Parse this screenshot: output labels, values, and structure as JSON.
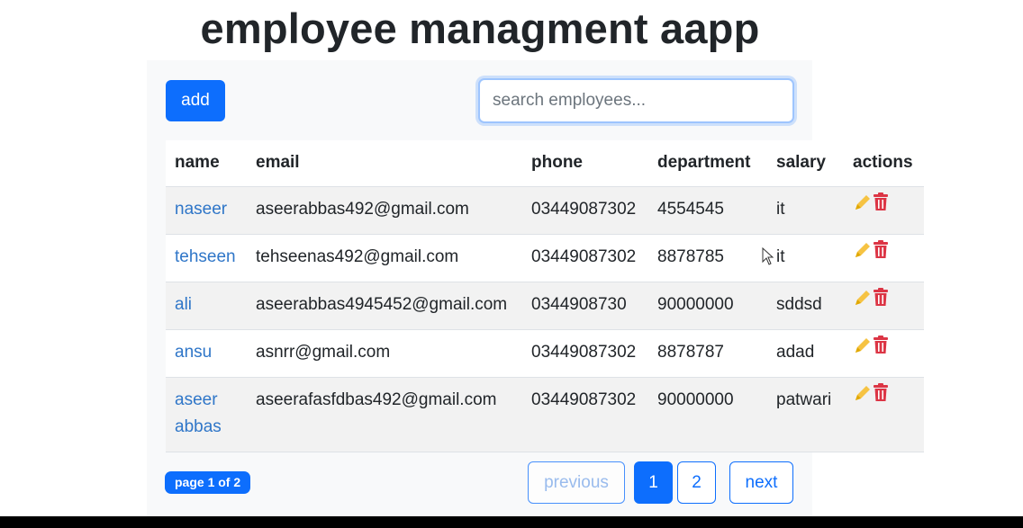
{
  "app": {
    "title": "employee managment aapp"
  },
  "toolbar": {
    "add_label": "add",
    "search_placeholder": "search employees...",
    "search_value": ""
  },
  "table": {
    "headers": {
      "name": "name",
      "email": "email",
      "phone": "phone",
      "department": "department",
      "salary": "salary",
      "actions": "actions"
    },
    "rows": [
      {
        "name": "naseer",
        "email": "aseerabbas492@gmail.com",
        "phone": "03449087302",
        "department": "4554545",
        "salary": "it"
      },
      {
        "name": "tehseen",
        "email": "tehseenas492@gmail.com",
        "phone": "03449087302",
        "department": "8878785",
        "salary": "it"
      },
      {
        "name": "ali",
        "email": "aseerabbas4945452@gmail.com",
        "phone": "0344908730",
        "department": "90000000",
        "salary": "sddsd"
      },
      {
        "name": "ansu",
        "email": "asnrr@gmail.com",
        "phone": "03449087302",
        "department": "8878787",
        "salary": "adad"
      },
      {
        "name": "aseer abbas",
        "email": "aseerafasfdbas492@gmail.com",
        "phone": "03449087302",
        "department": "90000000",
        "salary": "patwari"
      }
    ],
    "row_actions": [
      "edit-icon",
      "delete-icon"
    ]
  },
  "pagination": {
    "status": "page 1 of 2",
    "previous_label": "previous",
    "page_1": "1",
    "page_2": "2",
    "next_label": "next",
    "current_page": 1
  },
  "colors": {
    "primary": "#0d6efd",
    "link": "#2f76c8",
    "edit_icon": "#f6c343",
    "delete_icon": "#dc3545"
  }
}
